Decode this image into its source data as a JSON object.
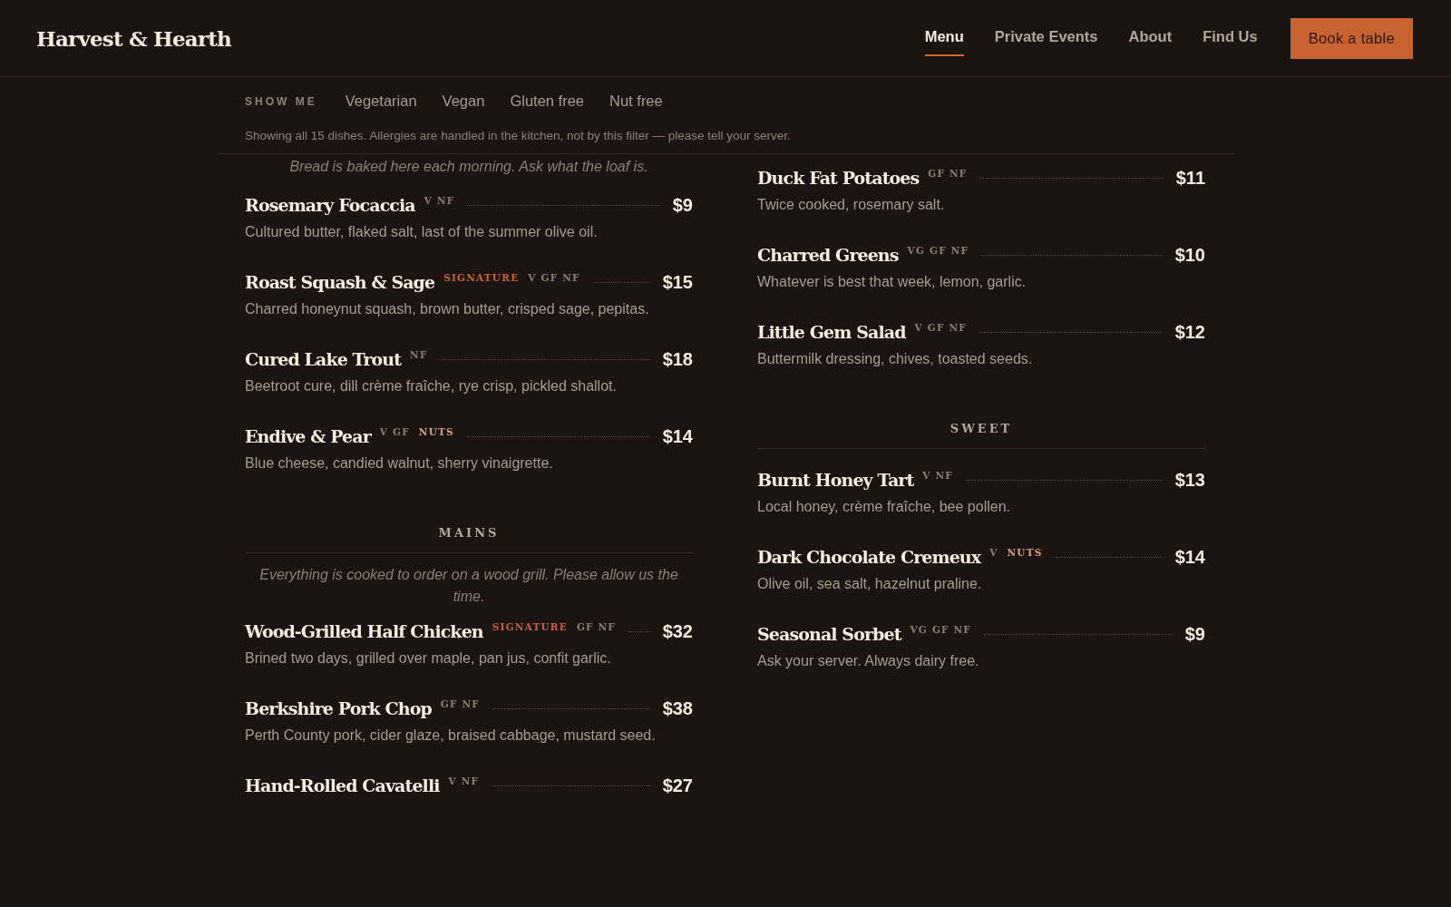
{
  "header": {
    "logo": "Harvest & Hearth",
    "nav": [
      {
        "label": "Menu",
        "selected": true
      },
      {
        "label": "Private Events",
        "selected": false
      },
      {
        "label": "About",
        "selected": false
      },
      {
        "label": "Find Us",
        "selected": false
      }
    ],
    "cta": "Book a table"
  },
  "filters": {
    "label": "SHOW ME",
    "options": [
      {
        "label": "Vegetarian",
        "selected": false
      },
      {
        "label": "Vegan",
        "selected": false
      },
      {
        "label": "Gluten free",
        "selected": false
      },
      {
        "label": "Nut free",
        "selected": false
      }
    ],
    "note": "Showing all 15 dishes. Allergies are handled in the kitchen, not by this filter — please tell your server."
  },
  "columns": [
    {
      "blocks": [
        {
          "kind": "note",
          "text": "Bread is baked here each morning. Ask what the loaf is."
        },
        {
          "kind": "item",
          "name": "Rosemary Focaccia",
          "tags": [
            {
              "kind": "diet",
              "text": "V NF"
            }
          ],
          "price": "$9",
          "description": "Cultured butter, flaked salt, last of the summer olive oil."
        },
        {
          "kind": "item",
          "name": "Roast Squash & Sage",
          "tags": [
            {
              "kind": "signature",
              "text": "SIGNATURE"
            },
            {
              "kind": "diet",
              "text": "V GF NF"
            }
          ],
          "price": "$15",
          "description": "Charred honeynut squash, brown butter, crisped sage, pepitas."
        },
        {
          "kind": "item",
          "name": "Cured Lake Trout",
          "tags": [
            {
              "kind": "diet",
              "text": "NF"
            }
          ],
          "price": "$18",
          "description": "Beetroot cure, dill crème fraîche, rye crisp, pickled shallot."
        },
        {
          "kind": "item",
          "name": "Endive & Pear",
          "tags": [
            {
              "kind": "diet",
              "text": "V GF"
            },
            {
              "kind": "nuts",
              "text": "NUTS"
            }
          ],
          "price": "$14",
          "description": "Blue cheese, candied walnut, sherry vinaigrette."
        },
        {
          "kind": "section",
          "title": "MAINS"
        },
        {
          "kind": "note",
          "text": "Everything is cooked to order on a wood grill. Please allow us the time."
        },
        {
          "kind": "item",
          "name": "Wood-Grilled Half Chicken",
          "tags": [
            {
              "kind": "signature",
              "text": "SIGNATURE"
            },
            {
              "kind": "diet",
              "text": "GF NF"
            }
          ],
          "price": "$32",
          "description": "Brined two days, grilled over maple, pan jus, confit garlic."
        },
        {
          "kind": "item",
          "name": "Berkshire Pork Chop",
          "tags": [
            {
              "kind": "diet",
              "text": "GF NF"
            }
          ],
          "price": "$38",
          "description": "Perth County pork, cider glaze, braised cabbage, mustard seed."
        },
        {
          "kind": "item",
          "name": "Hand-Rolled Cavatelli",
          "tags": [
            {
              "kind": "diet",
              "text": "V NF"
            }
          ],
          "price": "$27"
        }
      ]
    },
    {
      "blocks": [
        {
          "kind": "item",
          "name": "Duck Fat Potatoes",
          "tags": [
            {
              "kind": "diet",
              "text": "GF NF"
            }
          ],
          "price": "$11",
          "description": "Twice cooked, rosemary salt."
        },
        {
          "kind": "item",
          "name": "Charred Greens",
          "tags": [
            {
              "kind": "diet",
              "text": "VG GF NF"
            }
          ],
          "price": "$10",
          "description": "Whatever is best that week, lemon, garlic."
        },
        {
          "kind": "item",
          "name": "Little Gem Salad",
          "tags": [
            {
              "kind": "diet",
              "text": "V GF NF"
            }
          ],
          "price": "$12",
          "description": "Buttermilk dressing, chives, toasted seeds."
        },
        {
          "kind": "section",
          "title": "SWEET"
        },
        {
          "kind": "item",
          "name": "Burnt Honey Tart",
          "tags": [
            {
              "kind": "diet",
              "text": "V NF"
            }
          ],
          "price": "$13",
          "description": "Local honey, crème fraîche, bee pollen."
        },
        {
          "kind": "item",
          "name": "Dark Chocolate Cremeux",
          "tags": [
            {
              "kind": "diet",
              "text": "V"
            },
            {
              "kind": "nuts",
              "text": "NUTS"
            }
          ],
          "price": "$14",
          "description": "Olive oil, sea salt, hazelnut praline."
        },
        {
          "kind": "item",
          "name": "Seasonal Sorbet",
          "tags": [
            {
              "kind": "diet",
              "text": "VG GF NF"
            }
          ],
          "price": "$9",
          "description": "Ask your server. Always dairy free."
        }
      ]
    }
  ]
}
